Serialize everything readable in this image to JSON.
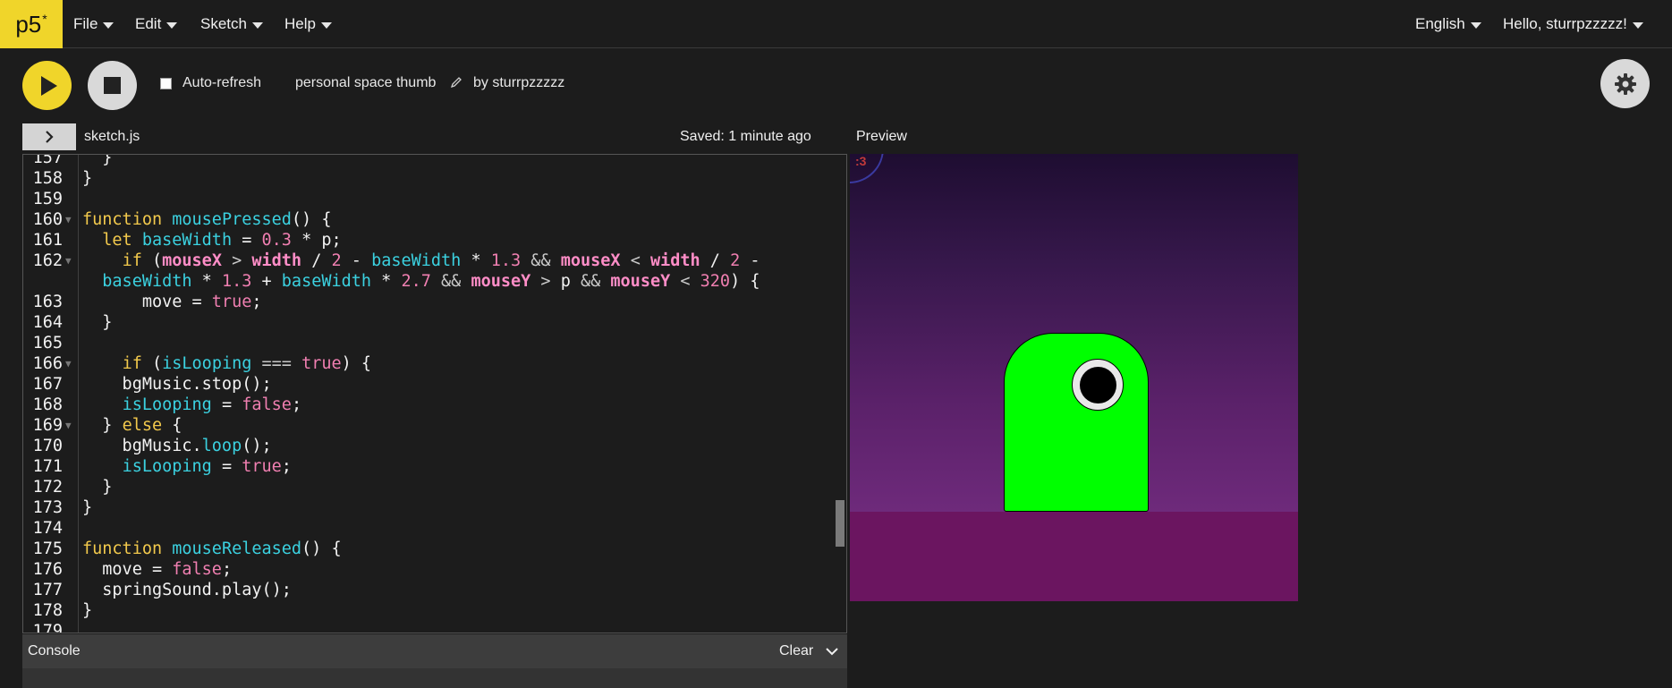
{
  "nav": {
    "logo": "p5",
    "logo_mark": "*",
    "menus": [
      "File",
      "Edit",
      "Sketch",
      "Help"
    ],
    "language": "English",
    "user_greeting": "Hello, sturrpzzzzz!"
  },
  "toolbar": {
    "auto_refresh_label": "Auto-refresh",
    "auto_refresh_checked": false,
    "sketch_name": "personal space thumb",
    "by_user": "by sturrpzzzzz"
  },
  "editor": {
    "file_name": "sketch.js",
    "saved_status": "Saved: 1 minute ago",
    "lines": [
      {
        "n": "157",
        "t": "  }"
      },
      {
        "n": "158",
        "t": "}"
      },
      {
        "n": "159",
        "t": ""
      },
      {
        "n": "160",
        "t": "function mousePressed() {"
      },
      {
        "n": "161",
        "t": "  let baseWidth = 0.3 * p;"
      },
      {
        "n": "162",
        "t": "    if (mouseX > width / 2 - baseWidth * 1.3 && mouseX < width / 2 -"
      },
      {
        "n": "",
        "t": "  baseWidth * 1.3 + baseWidth * 2.7 && mouseY > p && mouseY < 320) {"
      },
      {
        "n": "163",
        "t": "      move = true;"
      },
      {
        "n": "164",
        "t": "  }"
      },
      {
        "n": "165",
        "t": ""
      },
      {
        "n": "166",
        "t": "    if (isLooping === true) {"
      },
      {
        "n": "167",
        "t": "    bgMusic.stop();"
      },
      {
        "n": "168",
        "t": "    isLooping = false;"
      },
      {
        "n": "169",
        "t": "  } else {"
      },
      {
        "n": "170",
        "t": "    bgMusic.loop();"
      },
      {
        "n": "171",
        "t": "    isLooping = true;"
      },
      {
        "n": "172",
        "t": "  }"
      },
      {
        "n": "173",
        "t": "}"
      },
      {
        "n": "174",
        "t": ""
      },
      {
        "n": "175",
        "t": "function mouseReleased() {"
      },
      {
        "n": "176",
        "t": "  move = false;"
      },
      {
        "n": "177",
        "t": "  springSound.play();"
      },
      {
        "n": "178",
        "t": "}"
      },
      {
        "n": "179",
        "t": ""
      }
    ]
  },
  "preview": {
    "label": "Preview",
    "moon_text": ":3"
  },
  "console": {
    "title": "Console",
    "clear_label": "Clear"
  },
  "colors": {
    "accent": "#f0d52a",
    "creature": "#00ff00",
    "ground": "#6b1560"
  }
}
